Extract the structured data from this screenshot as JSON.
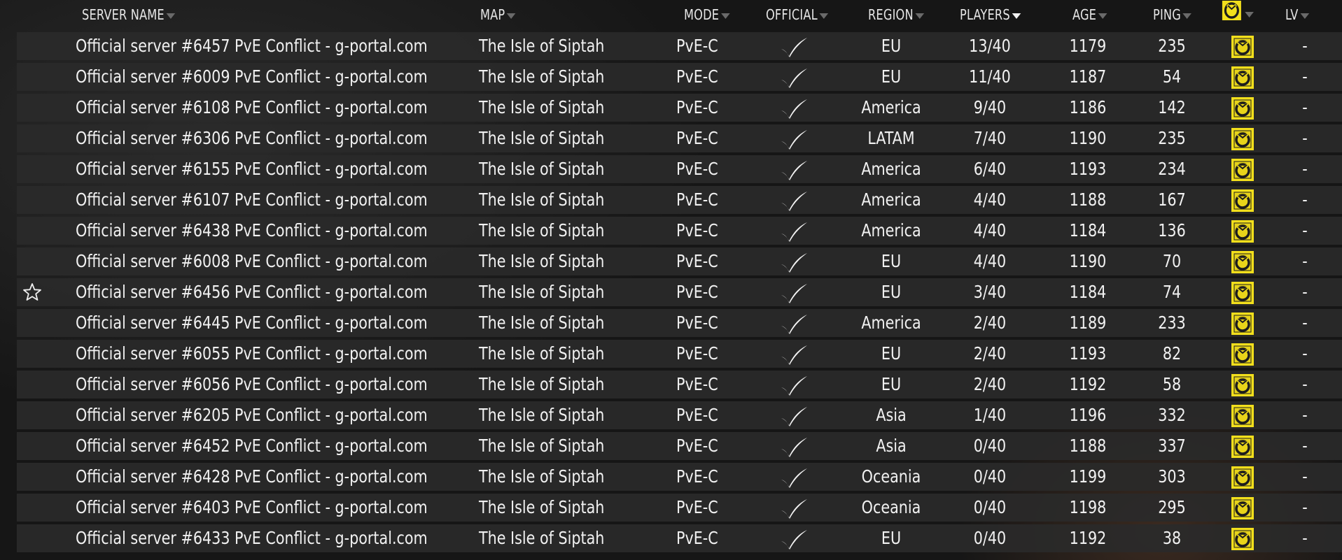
{
  "header": {
    "columns": [
      "SERVER NAME",
      "MAP",
      "MODE",
      "OFFICIAL",
      "REGION",
      "PLAYERS",
      "AGE",
      "PING",
      "LV"
    ],
    "mod_icon": "mod-icon",
    "sort_column": "PLAYERS"
  },
  "rows": [
    {
      "name": "Official server #6457 PvE Conflict - g-portal.com",
      "map": "The Isle of Siptah",
      "mode": "PvE-C",
      "official": true,
      "region": "EU",
      "players": "13/40",
      "age": "1179",
      "ping": "235",
      "lv": "-",
      "favorite": false
    },
    {
      "name": "Official server #6009 PvE Conflict - g-portal.com",
      "map": "The Isle of Siptah",
      "mode": "PvE-C",
      "official": true,
      "region": "EU",
      "players": "11/40",
      "age": "1187",
      "ping": "54",
      "lv": "-",
      "favorite": false
    },
    {
      "name": "Official server #6108 PvE Conflict - g-portal.com",
      "map": "The Isle of Siptah",
      "mode": "PvE-C",
      "official": true,
      "region": "America",
      "players": "9/40",
      "age": "1186",
      "ping": "142",
      "lv": "-",
      "favorite": false
    },
    {
      "name": "Official server #6306 PvE Conflict - g-portal.com",
      "map": "The Isle of Siptah",
      "mode": "PvE-C",
      "official": true,
      "region": "LATAM",
      "players": "7/40",
      "age": "1190",
      "ping": "235",
      "lv": "-",
      "favorite": false
    },
    {
      "name": "Official server #6155 PvE Conflict - g-portal.com",
      "map": "The Isle of Siptah",
      "mode": "PvE-C",
      "official": true,
      "region": "America",
      "players": "6/40",
      "age": "1193",
      "ping": "234",
      "lv": "-",
      "favorite": false
    },
    {
      "name": "Official server #6107 PvE Conflict - g-portal.com",
      "map": "The Isle of Siptah",
      "mode": "PvE-C",
      "official": true,
      "region": "America",
      "players": "4/40",
      "age": "1188",
      "ping": "167",
      "lv": "-",
      "favorite": false
    },
    {
      "name": "Official server #6438 PvE Conflict - g-portal.com",
      "map": "The Isle of Siptah",
      "mode": "PvE-C",
      "official": true,
      "region": "America",
      "players": "4/40",
      "age": "1184",
      "ping": "136",
      "lv": "-",
      "favorite": false
    },
    {
      "name": "Official server #6008 PvE Conflict - g-portal.com",
      "map": "The Isle of Siptah",
      "mode": "PvE-C",
      "official": true,
      "region": "EU",
      "players": "4/40",
      "age": "1190",
      "ping": "70",
      "lv": "-",
      "favorite": false
    },
    {
      "name": "Official server #6456 PvE Conflict - g-portal.com",
      "map": "The Isle of Siptah",
      "mode": "PvE-C",
      "official": true,
      "region": "EU",
      "players": "3/40",
      "age": "1184",
      "ping": "74",
      "lv": "-",
      "favorite": true
    },
    {
      "name": "Official server #6445 PvE Conflict - g-portal.com",
      "map": "The Isle of Siptah",
      "mode": "PvE-C",
      "official": true,
      "region": "America",
      "players": "2/40",
      "age": "1189",
      "ping": "233",
      "lv": "-",
      "favorite": false
    },
    {
      "name": "Official server #6055 PvE Conflict - g-portal.com",
      "map": "The Isle of Siptah",
      "mode": "PvE-C",
      "official": true,
      "region": "EU",
      "players": "2/40",
      "age": "1193",
      "ping": "82",
      "lv": "-",
      "favorite": false
    },
    {
      "name": "Official server #6056 PvE Conflict - g-portal.com",
      "map": "The Isle of Siptah",
      "mode": "PvE-C",
      "official": true,
      "region": "EU",
      "players": "2/40",
      "age": "1192",
      "ping": "58",
      "lv": "-",
      "favorite": false
    },
    {
      "name": "Official server #6205 PvE Conflict - g-portal.com",
      "map": "The Isle of Siptah",
      "mode": "PvE-C",
      "official": true,
      "region": "Asia",
      "players": "1/40",
      "age": "1196",
      "ping": "332",
      "lv": "-",
      "favorite": false
    },
    {
      "name": "Official server #6452 PvE Conflict - g-portal.com",
      "map": "The Isle of Siptah",
      "mode": "PvE-C",
      "official": true,
      "region": "Asia",
      "players": "0/40",
      "age": "1188",
      "ping": "337",
      "lv": "-",
      "favorite": false
    },
    {
      "name": "Official server #6428 PvE Conflict - g-portal.com",
      "map": "The Isle of Siptah",
      "mode": "PvE-C",
      "official": true,
      "region": "Oceania",
      "players": "0/40",
      "age": "1199",
      "ping": "303",
      "lv": "-",
      "favorite": false
    },
    {
      "name": "Official server #6403 PvE Conflict - g-portal.com",
      "map": "The Isle of Siptah",
      "mode": "PvE-C",
      "official": true,
      "region": "Oceania",
      "players": "0/40",
      "age": "1198",
      "ping": "295",
      "lv": "-",
      "favorite": false
    },
    {
      "name": "Official server #6433 PvE Conflict - g-portal.com",
      "map": "The Isle of Siptah",
      "mode": "PvE-C",
      "official": true,
      "region": "EU",
      "players": "0/40",
      "age": "1192",
      "ping": "38",
      "lv": "-",
      "favorite": false
    }
  ],
  "colors": {
    "row_bg": "#2a2a2a",
    "text": "#f1f1f1",
    "icon_yellow": "#f2df1c",
    "icon_dark": "#1d1d1d",
    "caret_inactive": "#6a6a6a",
    "caret_active": "#f2f2f2"
  },
  "icons": {
    "official": "checkmark-icon",
    "favorite": "star-outline-icon",
    "mod": "mod-icon"
  }
}
